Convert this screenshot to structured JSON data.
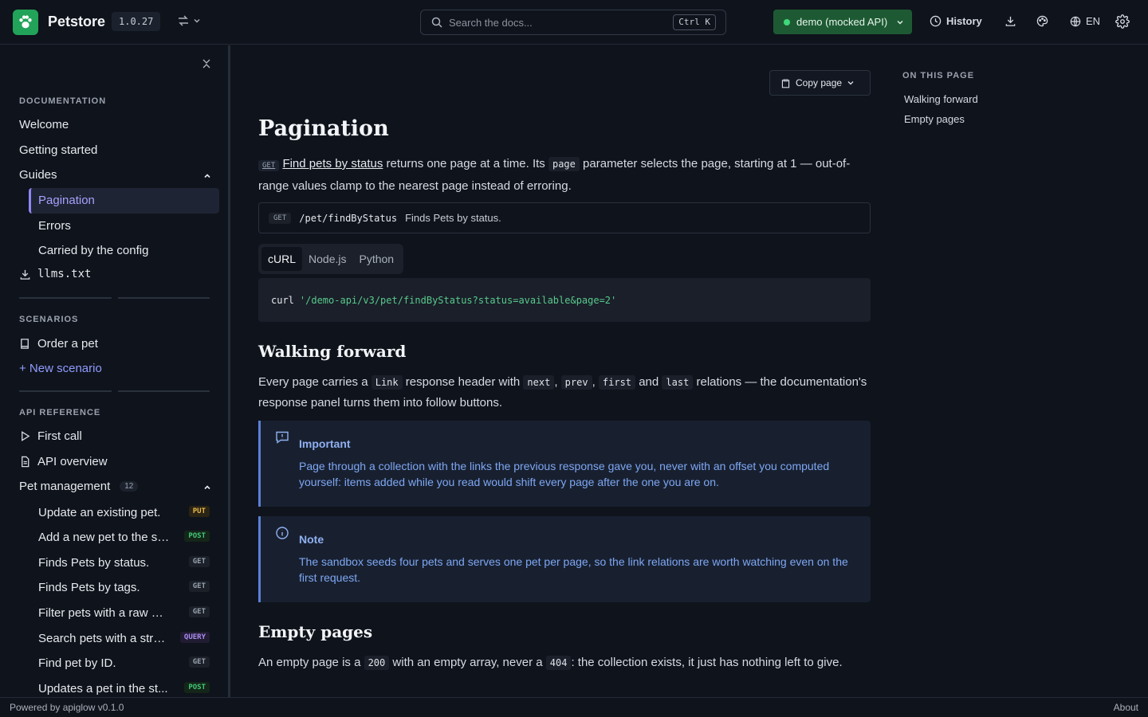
{
  "header": {
    "brand": "Petstore",
    "version": "1.0.27",
    "search_placeholder": "Search the docs...",
    "search_shortcut": "Ctrl K",
    "environment": "demo (mocked API)",
    "history": "History",
    "language": "EN",
    "accent_color": "#22a35a"
  },
  "sidebar": {
    "documentation_title": "DOCUMENTATION",
    "welcome": "Welcome",
    "getting_started": "Getting started",
    "guides": "Guides",
    "guides_items": [
      "Pagination",
      "Errors",
      "Carried by the config"
    ],
    "llms": "llms.txt",
    "scenarios_title": "SCENARIOS",
    "order_pet": "Order a pet",
    "new_scenario": "+ New scenario",
    "api_title": "API REFERENCE",
    "first_call": "First call",
    "api_overview": "API overview",
    "pet_management": "Pet management",
    "pet_count": "12",
    "endpoints": [
      {
        "label": "Update an existing pet.",
        "method": "PUT"
      },
      {
        "label": "Add a new pet to the st...",
        "method": "POST"
      },
      {
        "label": "Finds Pets by status.",
        "method": "GET"
      },
      {
        "label": "Finds Pets by tags.",
        "method": "GET"
      },
      {
        "label": "Filter pets with a raw qu...",
        "method": "GET"
      },
      {
        "label": "Search pets with a stru...",
        "method": "QUERY"
      },
      {
        "label": "Find pet by ID.",
        "method": "GET"
      },
      {
        "label": "Updates a pet in the st...",
        "method": "POST"
      }
    ]
  },
  "main": {
    "copy_page": "Copy page",
    "title": "Pagination",
    "intro": {
      "get_tag": "GET",
      "link": "Find pets by status",
      "t1": " returns one page at a time. Its ",
      "code": "page",
      "t2": " parameter selects the page, starting at 1 — out-of-range values clamp to the nearest page instead of erroring."
    },
    "endpoint": {
      "method": "GET",
      "path": "/pet/findByStatus",
      "desc": "Finds Pets by status."
    },
    "tabs": [
      "cURL",
      "Node.js",
      "Python"
    ],
    "code": {
      "cmd": "curl",
      "arg": "'/demo-api/v3/pet/findByStatus?status=available&page=2'"
    },
    "walking_title": "Walking forward",
    "walking": {
      "t1": "Every page carries a ",
      "c1": "Link",
      "t2": " response header with ",
      "c2": "next",
      "t3": ", ",
      "c3": "prev",
      "t4": ", ",
      "c4": "first",
      "t5": " and ",
      "c5": "last",
      "t6": " relations — the documentation's response panel turns them into follow buttons."
    },
    "important": {
      "title": "Important",
      "body": "Page through a collection with the links the previous response gave you, never with an offset you computed yourself: items added while you read would shift every page after the one you are on."
    },
    "note": {
      "title": "Note",
      "body": "The sandbox seeds four pets and serves one pet per page, so the link relations are worth watching even on the first request."
    },
    "empty_title": "Empty pages",
    "empty": {
      "t1": "An empty page is a ",
      "c1": "200",
      "t2": " with an empty array, never a ",
      "c2": "404",
      "t3": ": the collection exists, it just has nothing left to give."
    }
  },
  "toc": {
    "title": "ON THIS PAGE",
    "items": [
      "Walking forward",
      "Empty pages"
    ]
  },
  "footer": {
    "powered": "Powered by apiglow v0.1.0",
    "about": "About"
  }
}
